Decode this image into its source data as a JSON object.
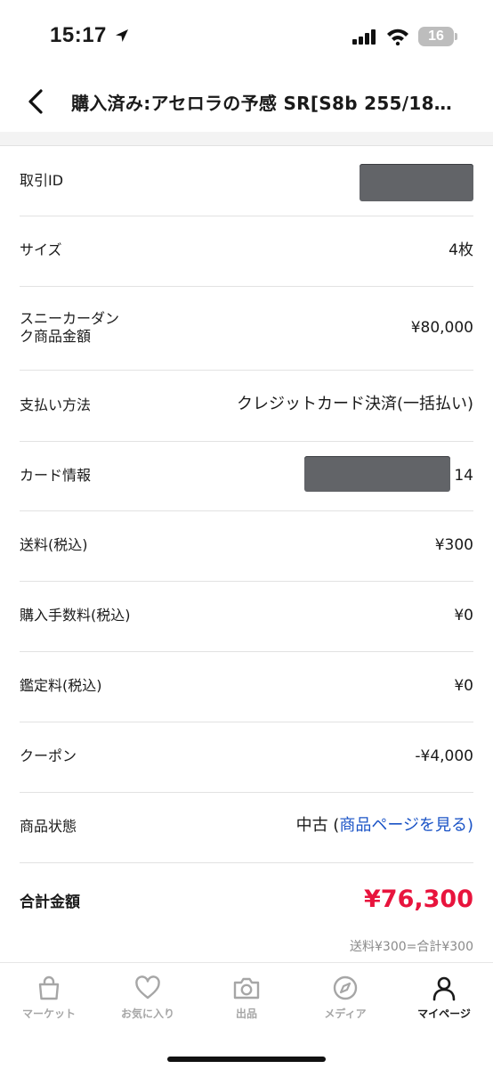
{
  "status_bar": {
    "time": "15:17",
    "battery": "16"
  },
  "header": {
    "title": "購入済み:アセロラの予感 SR[S8b 255/18…"
  },
  "details": {
    "transaction_id": {
      "label": "取引ID"
    },
    "size": {
      "label": "サイズ",
      "value": "4枚"
    },
    "item_price": {
      "label_line1": "スニーカーダン",
      "label_line2": "ク商品金額",
      "value": "¥80,000"
    },
    "payment_method": {
      "label": "支払い方法",
      "value": "クレジットカード決済(一括払い)"
    },
    "card_info": {
      "label": "カード情報",
      "value_suffix": "14"
    },
    "shipping": {
      "label": "送料(税込)",
      "value": "¥300"
    },
    "purchase_fee": {
      "label": "購入手数料(税込)",
      "value": "¥0"
    },
    "appraisal_fee": {
      "label": "鑑定料(税込)",
      "value": "¥0"
    },
    "coupon": {
      "label": "クーポン",
      "value": "-¥4,000"
    },
    "condition": {
      "label": "商品状態",
      "value": "中古 (",
      "link": "商品ページを見る",
      "value_close": ")"
    },
    "total": {
      "label": "合計金額",
      "value": "¥76,300"
    }
  },
  "footnote": {
    "line1": "送料¥300=合計¥300"
  },
  "tabs": [
    {
      "label": "マーケット",
      "icon": "bag-icon",
      "active": false
    },
    {
      "label": "お気に入り",
      "icon": "heart-icon",
      "active": false
    },
    {
      "label": "出品",
      "icon": "camera-icon",
      "active": false
    },
    {
      "label": "メディア",
      "icon": "compass-icon",
      "active": false
    },
    {
      "label": "マイページ",
      "icon": "person-icon",
      "active": true
    }
  ],
  "colors": {
    "total_red": "#e8143d",
    "link_blue": "#1a53c6",
    "tab_inactive": "#a6a6a6",
    "tab_active": "#1a1a1a"
  }
}
